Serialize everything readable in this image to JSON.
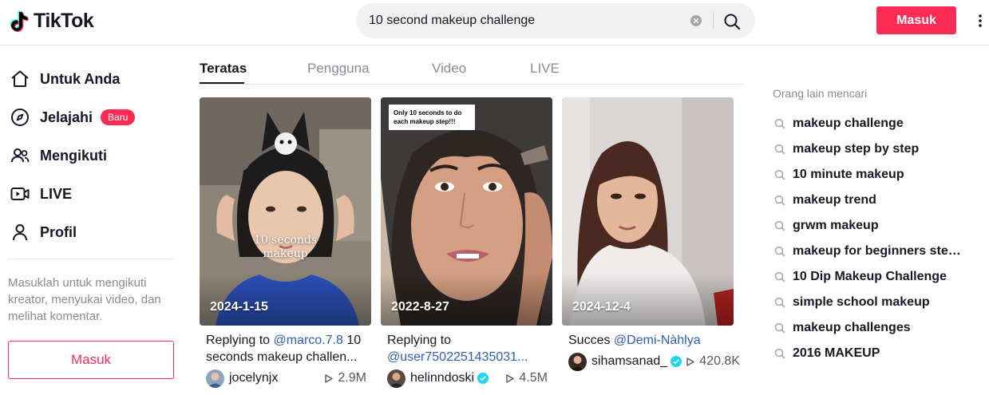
{
  "header": {
    "logo_text": "TikTok",
    "search_value": "10 second makeup challenge",
    "login_label": "Masuk"
  },
  "sidebar": {
    "items": [
      {
        "label": "Untuk Anda",
        "icon": "home-icon"
      },
      {
        "label": "Jelajahi",
        "icon": "compass-icon",
        "badge": "Baru"
      },
      {
        "label": "Mengikuti",
        "icon": "people-icon"
      },
      {
        "label": "LIVE",
        "icon": "live-icon"
      },
      {
        "label": "Profil",
        "icon": "profile-icon"
      }
    ],
    "note": "Masuklah untuk mengikuti kreator, menyukai video, dan melihat komentar.",
    "login_label": "Masuk"
  },
  "tabs": [
    {
      "label": "Teratas",
      "active": true
    },
    {
      "label": "Pengguna",
      "active": false
    },
    {
      "label": "Video",
      "active": false
    },
    {
      "label": "LIVE",
      "active": false
    }
  ],
  "videos": [
    {
      "date": "2024-1-15",
      "overlay_text": [
        "10 seconds",
        "makeup"
      ],
      "caption_prefix": "Replying to ",
      "caption_mention": "@marco.7.8",
      "caption_rest": " 10",
      "caption_line2": "seconds makeup challen...",
      "username": "jocelynjx",
      "verified": false,
      "views": "2.9M"
    },
    {
      "date": "2022-8-27",
      "overlay_note": "Only 10 seconds to do each makeup step!!!",
      "caption_prefix": "Replying to",
      "caption_mention": "",
      "caption_rest": "",
      "caption_line2": "@user7502251435031...",
      "username": "helinndoski",
      "verified": true,
      "views": "4.5M"
    },
    {
      "date": "2024-12-4",
      "caption_prefix": "Succes ",
      "caption_mention": "@Demi-Nàhlya",
      "caption_rest": "",
      "caption_line2": "",
      "username": "sihamsanad_",
      "verified": true,
      "views": "420.8K"
    }
  ],
  "related": {
    "title": "Orang lain mencari",
    "items": [
      "makeup challenge",
      "makeup step by step",
      "10 minute makeup",
      "makeup trend",
      "grwm makeup",
      "makeup for beginners step by step",
      "10 Dip Makeup Challenge",
      "simple school makeup",
      "makeup challenges",
      "2016 MAKEUP"
    ]
  },
  "colors": {
    "accent": "#fe2c55",
    "mention": "#2b5db9",
    "verified": "#20d5ec"
  }
}
